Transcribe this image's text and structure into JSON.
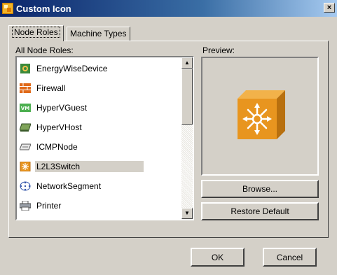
{
  "window": {
    "title": "Custom Icon",
    "close_glyph": "×"
  },
  "tabs": [
    {
      "label": "Node Roles",
      "active": true
    },
    {
      "label": "Machine Types",
      "active": false
    }
  ],
  "list": {
    "label": "All Node Roles:",
    "items": [
      {
        "label": "EnergyWiseDevice",
        "icon": "energywise-icon"
      },
      {
        "label": "Firewall",
        "icon": "firewall-icon"
      },
      {
        "label": "HyperVGuest",
        "icon": "vm-icon"
      },
      {
        "label": "HyperVHost",
        "icon": "host-icon"
      },
      {
        "label": "ICMPNode",
        "icon": "icmp-node-icon"
      },
      {
        "label": "L2L3Switch",
        "icon": "switch-icon",
        "selected": true
      },
      {
        "label": "NetworkSegment",
        "icon": "network-segment-icon"
      },
      {
        "label": "Printer",
        "icon": "printer-icon"
      }
    ]
  },
  "preview": {
    "label": "Preview:",
    "icon": "l2l3-switch-cube-icon"
  },
  "buttons": {
    "browse": "Browse...",
    "restore_default": "Restore Default",
    "ok": "OK",
    "cancel": "Cancel"
  },
  "colors": {
    "titlebar_start": "#0a246a",
    "dialog_bg": "#d4d0c8",
    "switch_orange": "#e8951f"
  }
}
